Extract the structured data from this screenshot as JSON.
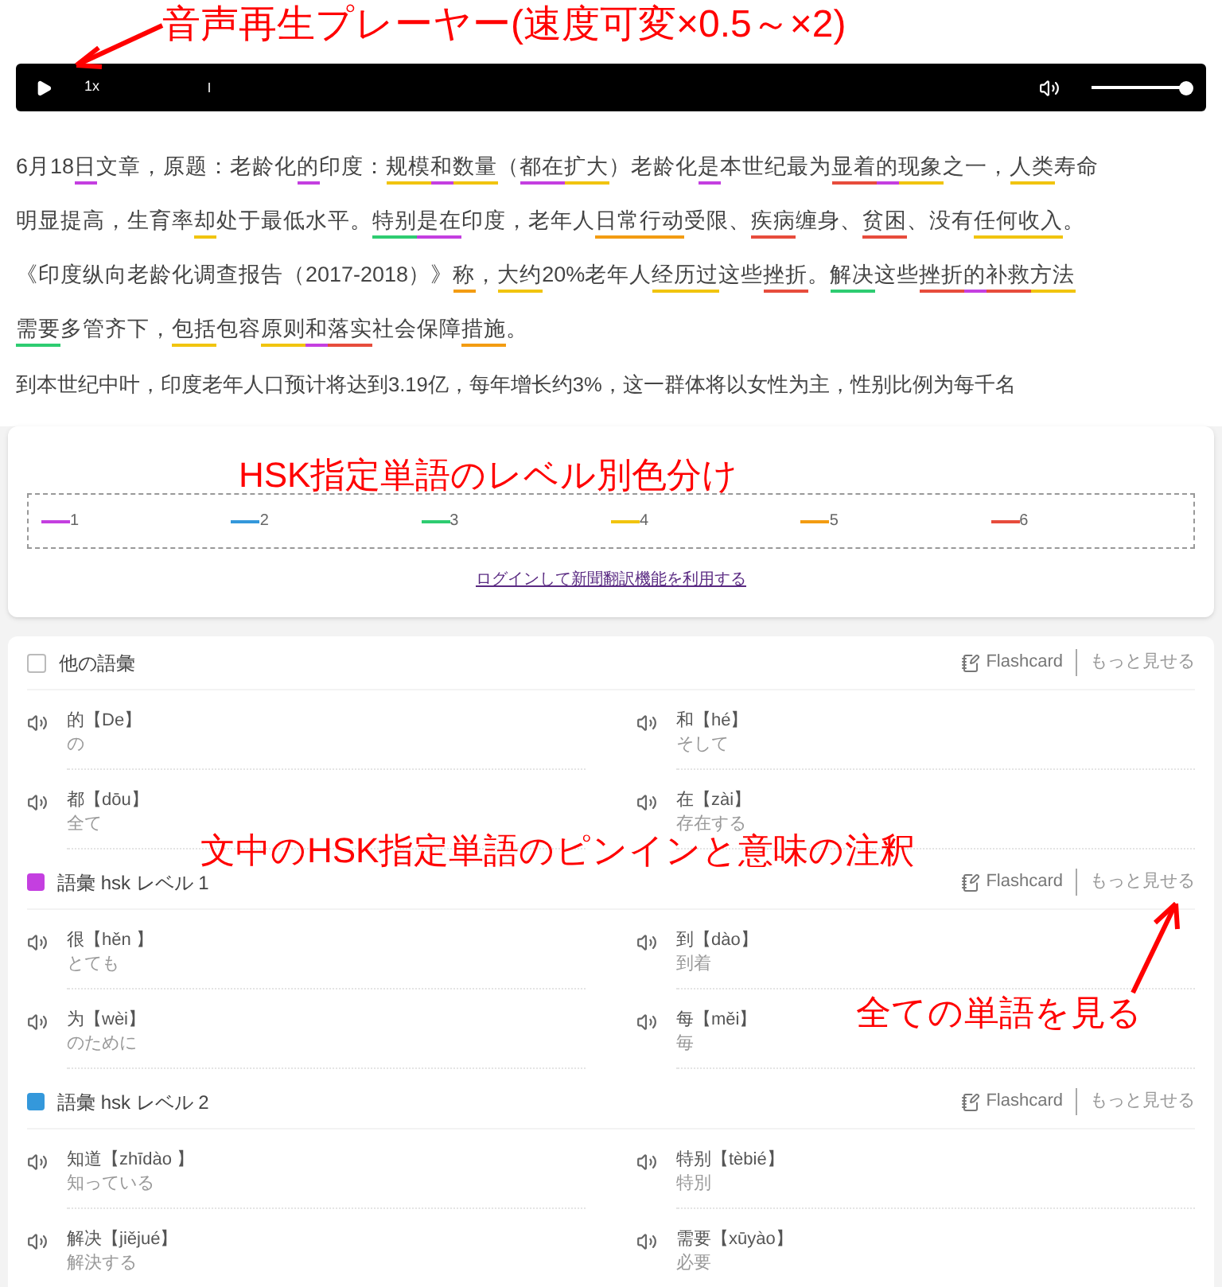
{
  "annotations": [
    {
      "text": "音声再生プレーヤー(速度可変×0.5～×2)"
    },
    {
      "text": "HSK指定単語のレベル別色分け"
    },
    {
      "text": "文中のHSK指定単語のピンインと意味の注釈"
    },
    {
      "text": "全ての単語を見る"
    }
  ],
  "player": {
    "speed": "1x",
    "volume": {
      "level": 1
    }
  },
  "article": {
    "lines": [
      [
        {
          "text": "6月18"
        },
        {
          "text": "日",
          "color": "#c43fe0"
        },
        {
          "text": "文章，原题：老龄化"
        },
        {
          "text": "的",
          "color": "#c43fe0"
        },
        {
          "text": "印度："
        },
        {
          "text": "规模",
          "color": "#f1c40f"
        },
        {
          "text": "和",
          "color": "#c43fe0"
        },
        {
          "text": "数量",
          "color": "#f1c40f"
        },
        {
          "text": "（"
        },
        {
          "text": "都",
          "color": "#c43fe0"
        },
        {
          "text": "在",
          "color": "#c43fe0"
        },
        {
          "text": "扩大",
          "color": "#f1c40f"
        },
        {
          "text": "）老龄化"
        },
        {
          "text": "是",
          "color": "#c43fe0"
        },
        {
          "text": "本世纪最为"
        },
        {
          "text": "显着",
          "color": "#e74c3c"
        },
        {
          "text": "的",
          "color": "#c43fe0"
        },
        {
          "text": "现象",
          "color": "#f1c40f"
        },
        {
          "text": "之一，"
        },
        {
          "text": "人类",
          "color": "#f1c40f"
        },
        {
          "text": "寿命"
        }
      ],
      [
        {
          "text": "明显提高，生育率"
        },
        {
          "text": "却",
          "color": "#f1c40f"
        },
        {
          "text": "处于最低水平。"
        },
        {
          "text": "特别",
          "color": "#2ecc71"
        },
        {
          "text": "是",
          "color": "#c43fe0"
        },
        {
          "text": "在",
          "color": "#c43fe0"
        },
        {
          "text": "印度，老年人"
        },
        {
          "text": "日常行动",
          "color": "#f39c12"
        },
        {
          "text": "受限、"
        },
        {
          "text": "疾病",
          "color": "#e74c3c"
        },
        {
          "text": "缠身、"
        },
        {
          "text": "贫困",
          "color": "#e74c3c"
        },
        {
          "text": "、没有"
        },
        {
          "text": "任何收入",
          "color": "#f1c40f"
        },
        {
          "text": "。"
        }
      ],
      [
        {
          "text": "《印度纵向老龄化调查报告（2017-2018）》"
        },
        {
          "text": "称",
          "color": "#f39c12"
        },
        {
          "text": "，"
        },
        {
          "text": "大约",
          "color": "#f1c40f"
        },
        {
          "text": "20%老年人"
        },
        {
          "text": "经历过",
          "color": "#f1c40f"
        },
        {
          "text": "这些"
        },
        {
          "text": "挫折",
          "color": "#e74c3c"
        },
        {
          "text": "。"
        },
        {
          "text": "解决",
          "color": "#2ecc71"
        },
        {
          "text": "这些"
        },
        {
          "text": "挫折",
          "color": "#e74c3c"
        },
        {
          "text": "的",
          "color": "#c43fe0"
        },
        {
          "text": "补救",
          "color": "#e74c3c"
        },
        {
          "text": "方法",
          "color": "#f1c40f"
        }
      ],
      [
        {
          "text": "需要",
          "color": "#2ecc71"
        },
        {
          "text": "多管齐下，"
        },
        {
          "text": "包括",
          "color": "#f1c40f"
        },
        {
          "text": "包容"
        },
        {
          "text": "原则",
          "color": "#f1c40f"
        },
        {
          "text": "和",
          "color": "#c43fe0"
        },
        {
          "text": "落实",
          "color": "#e74c3c"
        },
        {
          "text": "社会保障"
        },
        {
          "text": "措施",
          "color": "#f39c12"
        },
        {
          "text": "。"
        }
      ]
    ],
    "next_line": "到本世纪中叶，印度老年人口预计将达到3.19亿，每年增长约3%，这一群体将以女性为主，性别比例为每千名"
  },
  "legend": [
    {
      "label": "1",
      "color": "#c43fe0"
    },
    {
      "label": "2",
      "color": "#3498db"
    },
    {
      "label": "3",
      "color": "#2ecc71"
    },
    {
      "label": "4",
      "color": "#f1c40f"
    },
    {
      "label": "5",
      "color": "#f39c12"
    },
    {
      "label": "6",
      "color": "#e74c3c"
    }
  ],
  "login_link": "ログインして新聞翻訳機能を利用する",
  "vocab_sections": [
    {
      "kind": "plain",
      "checked": false,
      "title": "他の語彙",
      "flashcard": "Flashcard",
      "more": "もっと見せる",
      "words": [
        {
          "word": "的【De】",
          "meaning": "の"
        },
        {
          "word": "和【hé】",
          "meaning": "そして"
        },
        {
          "word": "都【dōu】",
          "meaning": "全て"
        },
        {
          "word": "在【zài】",
          "meaning": "存在する"
        }
      ]
    },
    {
      "kind": "level",
      "color": "#c43fe0",
      "title": "語彙 hsk レベル 1",
      "flashcard": "Flashcard",
      "more": "もっと見せる",
      "words": [
        {
          "word": "很【hěn 】",
          "meaning": "とても"
        },
        {
          "word": "到【dào】",
          "meaning": "到着"
        },
        {
          "word": "为【wèi】",
          "meaning": "のために"
        },
        {
          "word": "每【měi】",
          "meaning": "毎"
        }
      ]
    },
    {
      "kind": "level",
      "color": "#3498db",
      "title": "語彙 hsk レベル 2",
      "flashcard": "Flashcard",
      "more": "もっと見せる",
      "words": [
        {
          "word": "知道【zhīdào 】",
          "meaning": "知っている"
        },
        {
          "word": "特别【tèbié】",
          "meaning": "特別"
        },
        {
          "word": "解决【jiějué】",
          "meaning": "解決する"
        },
        {
          "word": "需要【xūyào】",
          "meaning": "必要"
        }
      ]
    }
  ]
}
